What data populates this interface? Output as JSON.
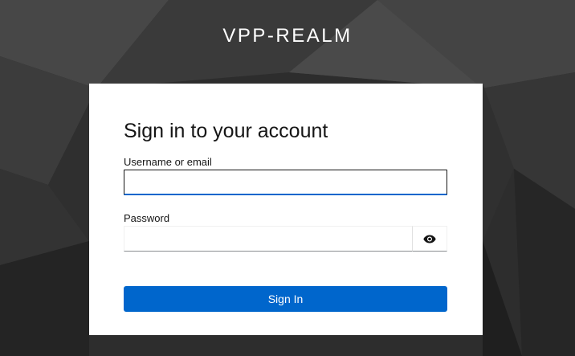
{
  "header": {
    "realm_title": "VPP-REALM"
  },
  "login_card": {
    "title": "Sign in to your account",
    "username_label": "Username or email",
    "username_value": "",
    "password_label": "Password",
    "password_value": "",
    "show_password_icon": "eye-icon",
    "submit_label": "Sign In"
  },
  "colors": {
    "background": "#2f2f2f",
    "card": "#ffffff",
    "primary": "#0066cc",
    "text": "#151515"
  }
}
